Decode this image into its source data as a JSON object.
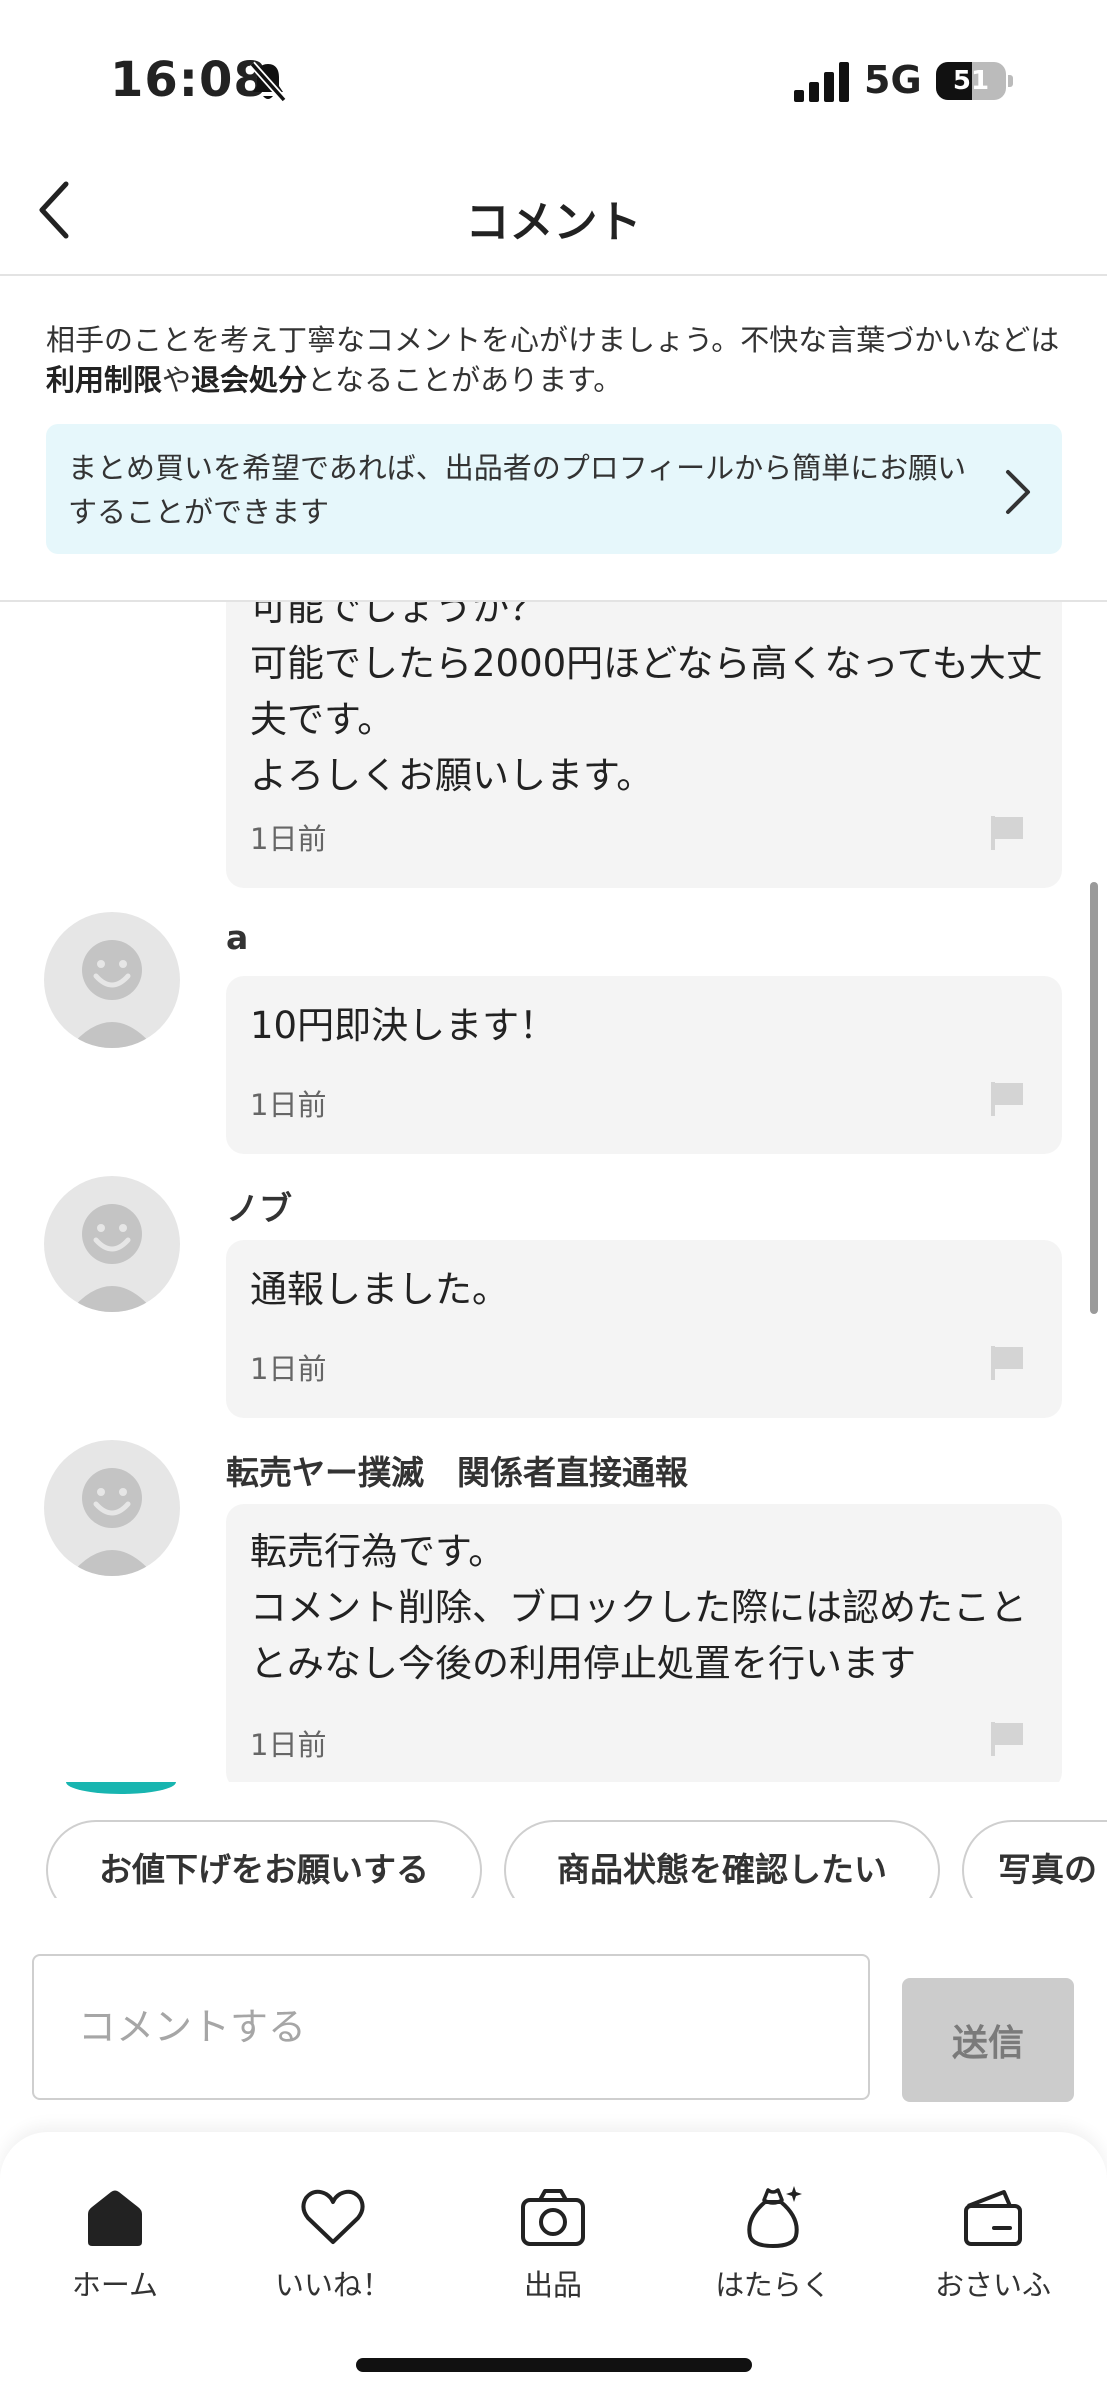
{
  "status_bar": {
    "time": "16:08",
    "network": "5G",
    "battery": "51",
    "battery_level": 0.51
  },
  "header": {
    "title": "コメント"
  },
  "notice": {
    "rule_part1": "相手のことを考え丁寧なコメントを心がけましょう。不快な言葉づかいなどは",
    "rule_bold1": "利用制限",
    "rule_part2": "や",
    "rule_bold2": "退会処分",
    "rule_part3": "となることがあります。",
    "banner_text": "まとめ買いを希望であれば、出品者のプロフィールから簡単にお願いすることができます"
  },
  "comments": [
    {
      "user": "",
      "message": "可能でしょうか？\n可能でしたら2000円ほどなら高くなっても大丈夫です。\nよろしくお願いします。",
      "time": "1日前"
    },
    {
      "user": "a",
      "message": "10円即決します！",
      "time": "1日前"
    },
    {
      "user": "ノブ",
      "message": "通報しました。",
      "time": "1日前"
    },
    {
      "user": "転売ヤー撲滅　関係者直接通報",
      "message": "転売行為です。\nコメント削除、ブロックした際には認めたこととみなし今後の利用停止処置を行います",
      "time": "1日前"
    }
  ],
  "quick_replies": [
    "お値下げをお願いする",
    "商品状態を確認したい",
    "写真の"
  ],
  "input": {
    "placeholder": "コメントする",
    "send_label": "送信"
  },
  "tabs": [
    {
      "label": "ホーム",
      "icon": "home-icon"
    },
    {
      "label": "いいね！",
      "icon": "heart-icon"
    },
    {
      "label": "出品",
      "icon": "camera-icon"
    },
    {
      "label": "はたらく",
      "icon": "money-bag-icon"
    },
    {
      "label": "おさいふ",
      "icon": "wallet-icon"
    }
  ],
  "colors": {
    "accent": "#18b5b0",
    "banner_bg": "#e6f7fb",
    "bubble_bg": "#f4f4f4",
    "send_disabled": "#cccccc"
  }
}
